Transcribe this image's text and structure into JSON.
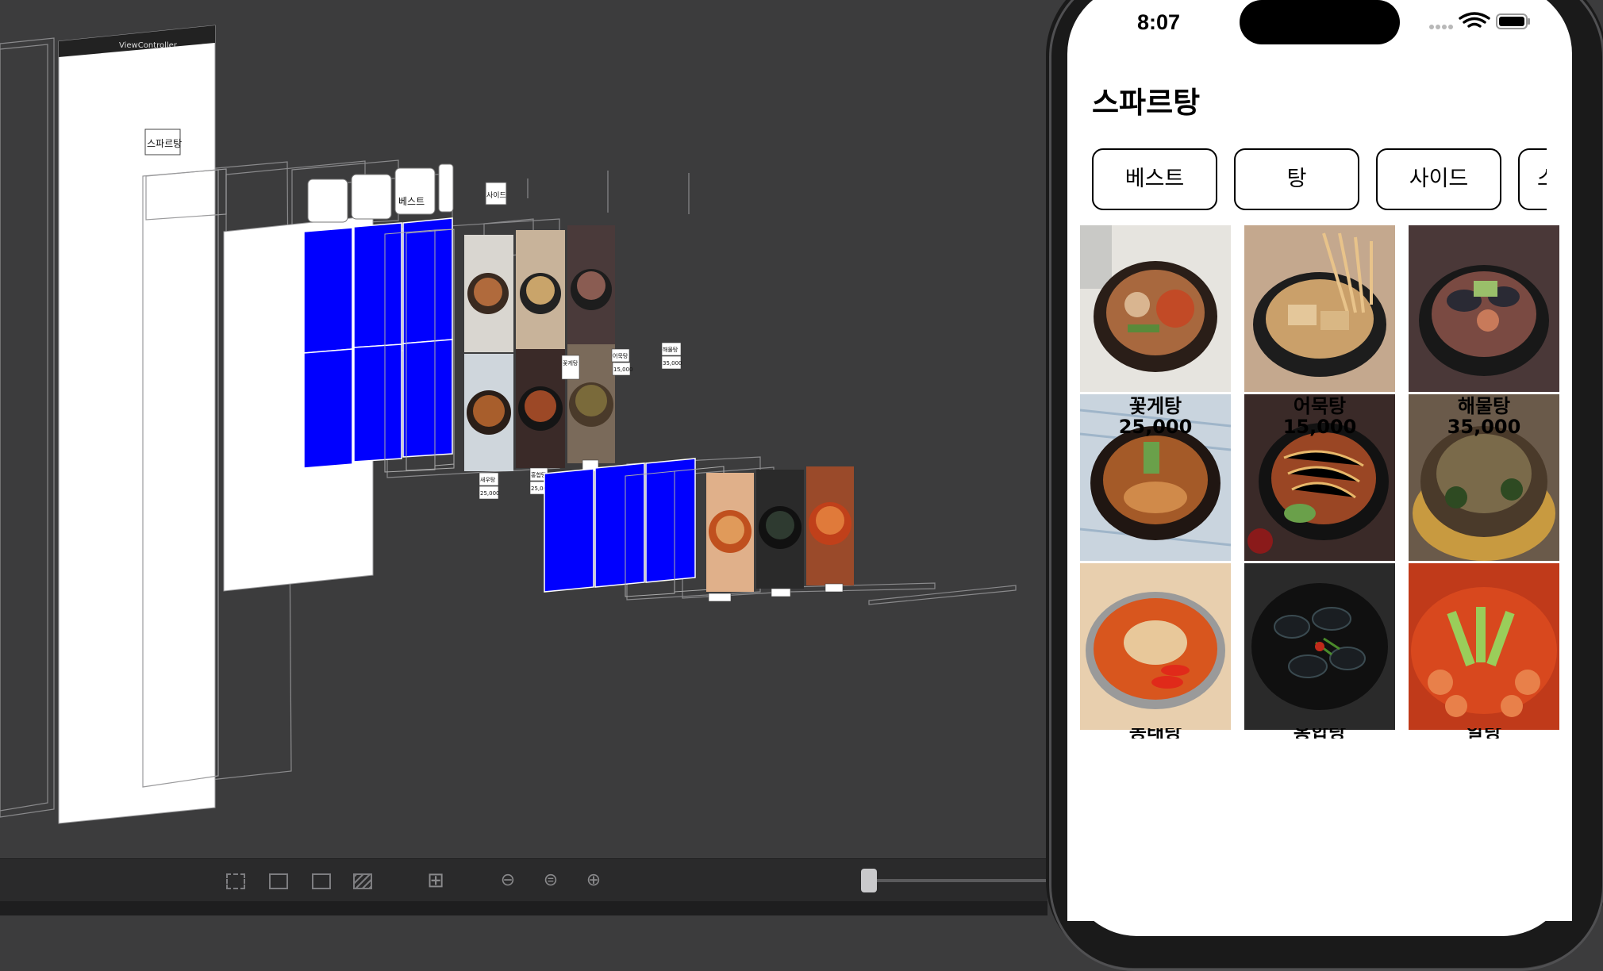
{
  "debugger": {
    "view_controller_label": "ViewController",
    "title_label": "스파르탕",
    "chip_best": "베스트",
    "chip_side": "사이드",
    "cell_labels": [
      "새우탕",
      "홍합탕",
      "꽃게탕",
      "어묵탕",
      "해물탕"
    ],
    "cell_prices": [
      "25,000",
      "25,000",
      "15,000",
      "35,000"
    ],
    "highlight_color": "#0000ff"
  },
  "toolbar": {
    "icons": [
      "layout-icon",
      "constraints-icon",
      "clipping-icon",
      "layers-icon",
      "grid-icon",
      "zoom-out-icon",
      "zoom-reset-icon",
      "zoom-in-icon"
    ]
  },
  "simulator": {
    "status_time": "8:07",
    "title": "스파르탕",
    "categories": [
      "베스트",
      "탕",
      "사이드",
      "스"
    ],
    "menu": [
      {
        "name": "꽃게탕",
        "price": "25,000"
      },
      {
        "name": "어묵탕",
        "price": "15,000"
      },
      {
        "name": "해물탕",
        "price": "35,000"
      },
      {
        "name": "동태탕",
        "price": ""
      },
      {
        "name": "홍합탕",
        "price": ""
      },
      {
        "name": "알탕",
        "price": ""
      },
      {
        "name": "부대탕",
        "price": ""
      },
      {
        "name": "홍합탕",
        "price": ""
      },
      {
        "name": "알탕",
        "price": ""
      }
    ]
  }
}
